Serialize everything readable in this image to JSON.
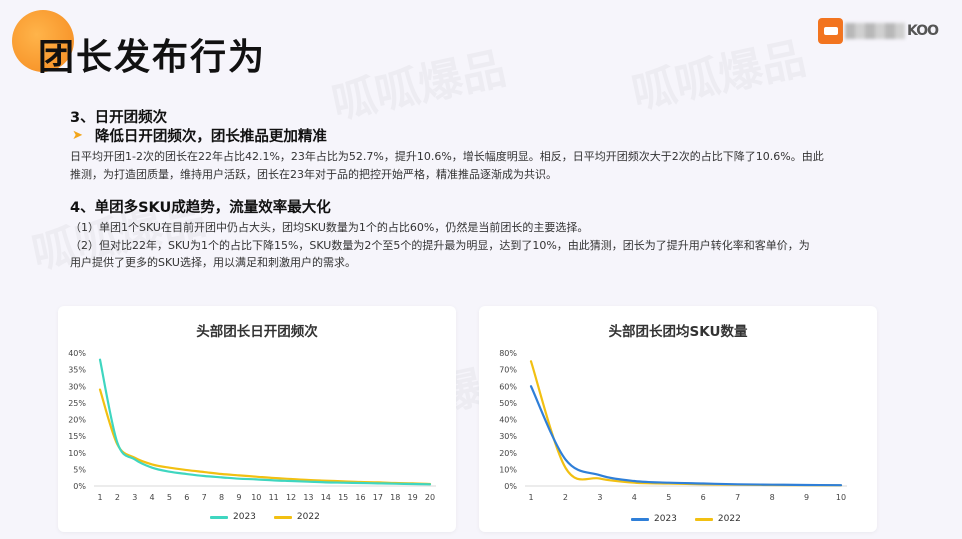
{
  "header": {
    "title": "团长发布行为",
    "logo_text": "KOO"
  },
  "watermark_text": "呱呱爆品",
  "section3": {
    "heading": "3、日开团频次",
    "subheading": "降低日开团频次，团长推品更加精准",
    "paragraph_lines": [
      "日平均开团1-2次的团长在22年占比42.1%，23年占比为52.7%，提升10.6%，增长幅度明显。相反，日平均开团频次大于2次的占比下降了10.6%。由此",
      "推测，为打造团质量，维持用户活跃，团长在23年对于品的把控开始严格，精准推品逐渐成为共识。"
    ]
  },
  "section4": {
    "heading": "4、单团多SKU成趋势，流量效率最大化",
    "paragraph_lines": [
      "（1）单团1个SKU在目前开团中仍占大头，团均SKU数量为1个的占比60%，仍然是当前团长的主要选择。",
      "（2）但对比22年，SKU为1个的占比下降15%，SKU数量为2个至5个的提升最为明显，达到了10%，由此猜测，团长为了提升用户转化率和客单价，为",
      "用户提供了更多的SKU选择，用以满足和刺激用户的需求。"
    ]
  },
  "colors": {
    "series_2023_left": "#3fd6c0",
    "series_2023_right": "#2f7fd8",
    "series_2022": "#f2c012"
  },
  "chart_data": [
    {
      "type": "line",
      "title": "头部团长日开团频次",
      "x": [
        1,
        2,
        3,
        4,
        5,
        6,
        7,
        8,
        9,
        10,
        11,
        12,
        13,
        14,
        15,
        16,
        17,
        18,
        19,
        20
      ],
      "ylim": [
        0,
        40
      ],
      "yticks": [
        "0%",
        "5%",
        "10%",
        "15%",
        "20%",
        "25%",
        "30%",
        "35%",
        "40%"
      ],
      "series": [
        {
          "name": "2023",
          "values": [
            38,
            13,
            8,
            5.5,
            4.3,
            3.6,
            3,
            2.6,
            2.2,
            2,
            1.7,
            1.5,
            1.3,
            1.1,
            1,
            0.9,
            0.8,
            0.7,
            0.6,
            0.5
          ]
        },
        {
          "name": "2022",
          "values": [
            29,
            12.5,
            8.5,
            6.5,
            5.5,
            4.8,
            4.2,
            3.6,
            3.2,
            2.8,
            2.4,
            2.1,
            1.8,
            1.6,
            1.4,
            1.2,
            1.1,
            0.9,
            0.8,
            0.6
          ]
        }
      ]
    },
    {
      "type": "line",
      "title": "头部团长团均SKU数量",
      "x": [
        1,
        2,
        3,
        4,
        5,
        6,
        7,
        8,
        9,
        10
      ],
      "ylim": [
        0,
        80
      ],
      "yticks": [
        "0%",
        "10%",
        "20%",
        "30%",
        "40%",
        "50%",
        "60%",
        "70%",
        "80%"
      ],
      "series": [
        {
          "name": "2023",
          "values": [
            60,
            16,
            6.5,
            3,
            2,
            1.5,
            1,
            0.8,
            0.6,
            0.5
          ]
        },
        {
          "name": "2022",
          "values": [
            75,
            11,
            4.5,
            2,
            1.5,
            1,
            0.8,
            0.6,
            0.5,
            0.4
          ]
        }
      ]
    }
  ]
}
